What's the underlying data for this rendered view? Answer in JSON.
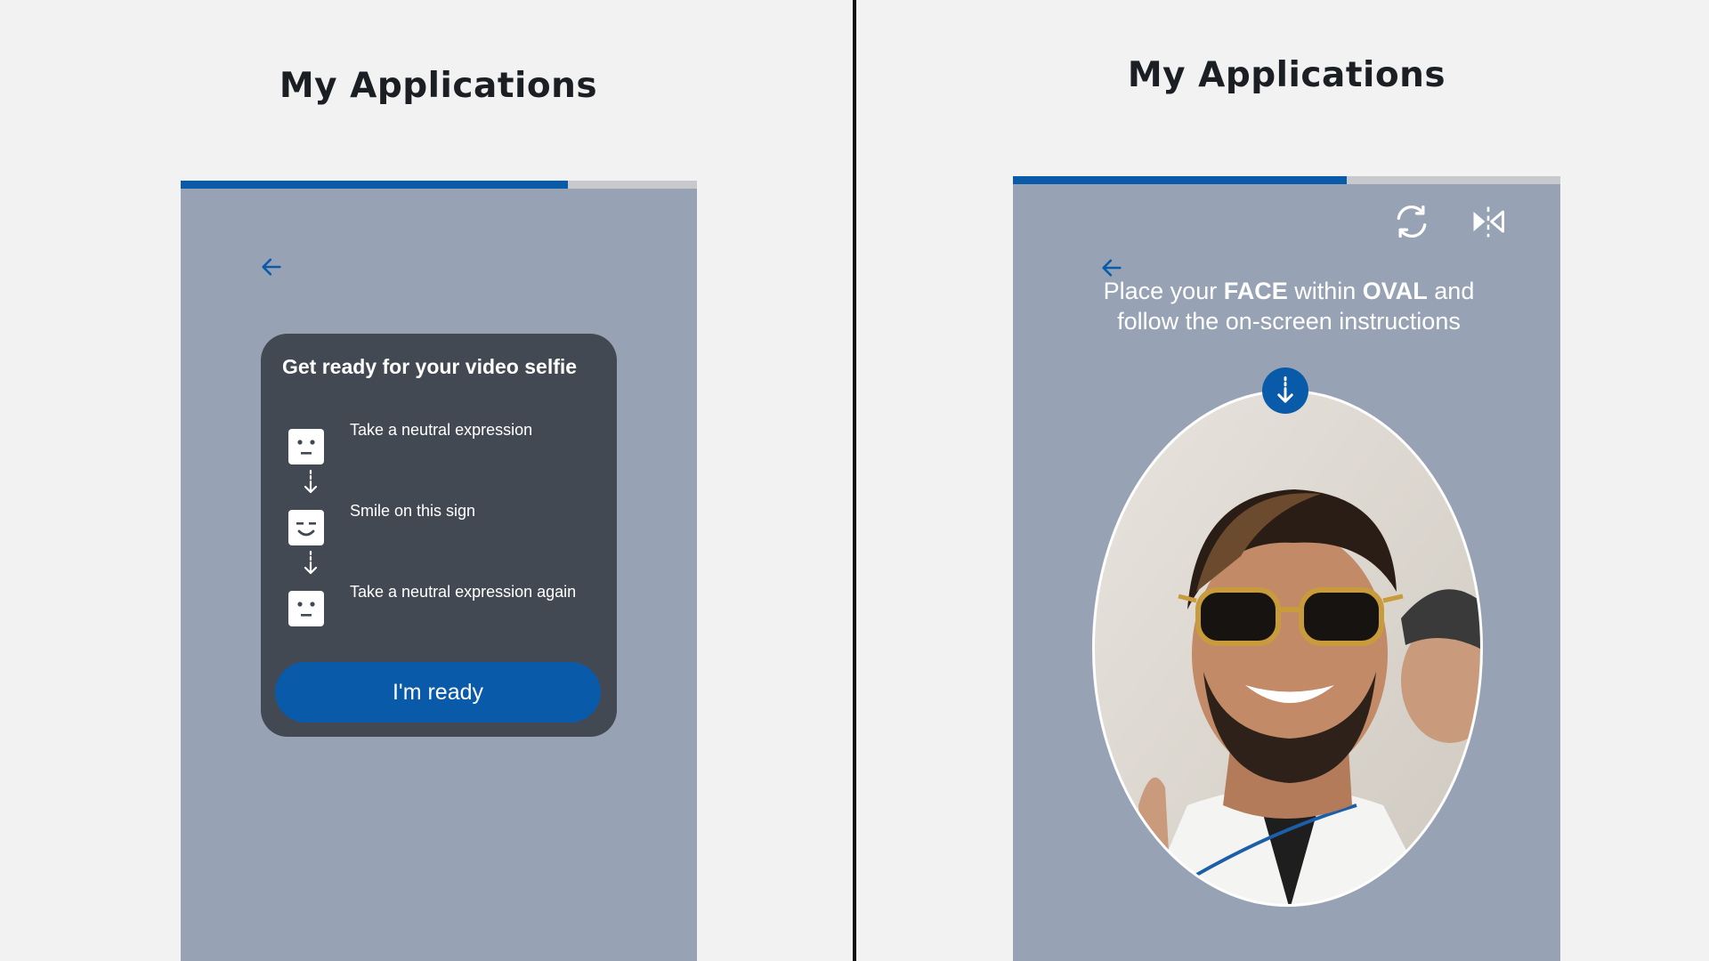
{
  "left_screen": {
    "page_title": "My Applications",
    "progress": 0.75,
    "card": {
      "title": "Get ready for your video selfie",
      "steps": [
        {
          "label": "Take a neutral expression",
          "icon": "neutral-face-icon"
        },
        {
          "label": "Smile on this sign",
          "icon": "smile-face-icon"
        },
        {
          "label": "Take a neutral expression again",
          "icon": "neutral-face-icon"
        }
      ],
      "ready_label": "I'm ready"
    }
  },
  "right_screen": {
    "page_title": "My Applications",
    "progress": 0.61,
    "instruction": {
      "t1": "Place your ",
      "b1": "FACE",
      "t2": " within ",
      "b2": "OVAL",
      "t3": " and follow the on-screen instructions"
    },
    "icons": [
      "back-arrow-icon",
      "switch-camera-icon",
      "mirror-flip-icon",
      "arrow-down-icon"
    ]
  },
  "colors": {
    "accent": "#0a5aaa",
    "screen_bg": "#97a3b4",
    "card_bg": "#434952",
    "page_bg": "#f2f2f2"
  }
}
